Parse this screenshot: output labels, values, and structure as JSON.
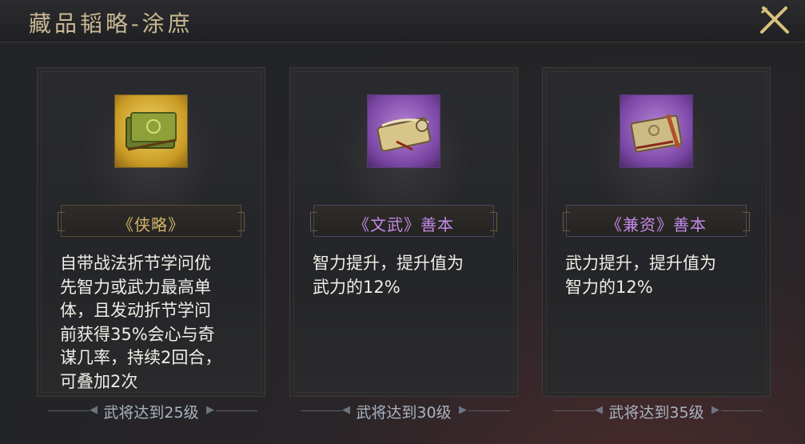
{
  "header": {
    "title": "藏品韬略-涂庶"
  },
  "cards": [
    {
      "icon": "gold-book-icon",
      "name": "《侠略》",
      "description_lines": [
        "自带战法折节学问优",
        "先智力或武力最高单",
        "体，且发动折节学问",
        "前获得35%会心与奇",
        "谋几率，持续2回合，",
        "可叠加2次"
      ],
      "requirement": "武将达到25级"
    },
    {
      "icon": "scroll-book-icon",
      "name": "《文武》善本",
      "description_lines": [
        "智力提升，提升值为",
        "武力的12%"
      ],
      "requirement": "武将达到30级"
    },
    {
      "icon": "scroll-book-icon",
      "name": "《兼资》善本",
      "description_lines": [
        "武力提升，提升值为",
        "智力的12%"
      ],
      "requirement": "武将达到35级"
    }
  ],
  "colors": {
    "gold_text": "#d4b46a",
    "purple_text": "#c48ae8",
    "body_text": "#f0ede6"
  }
}
